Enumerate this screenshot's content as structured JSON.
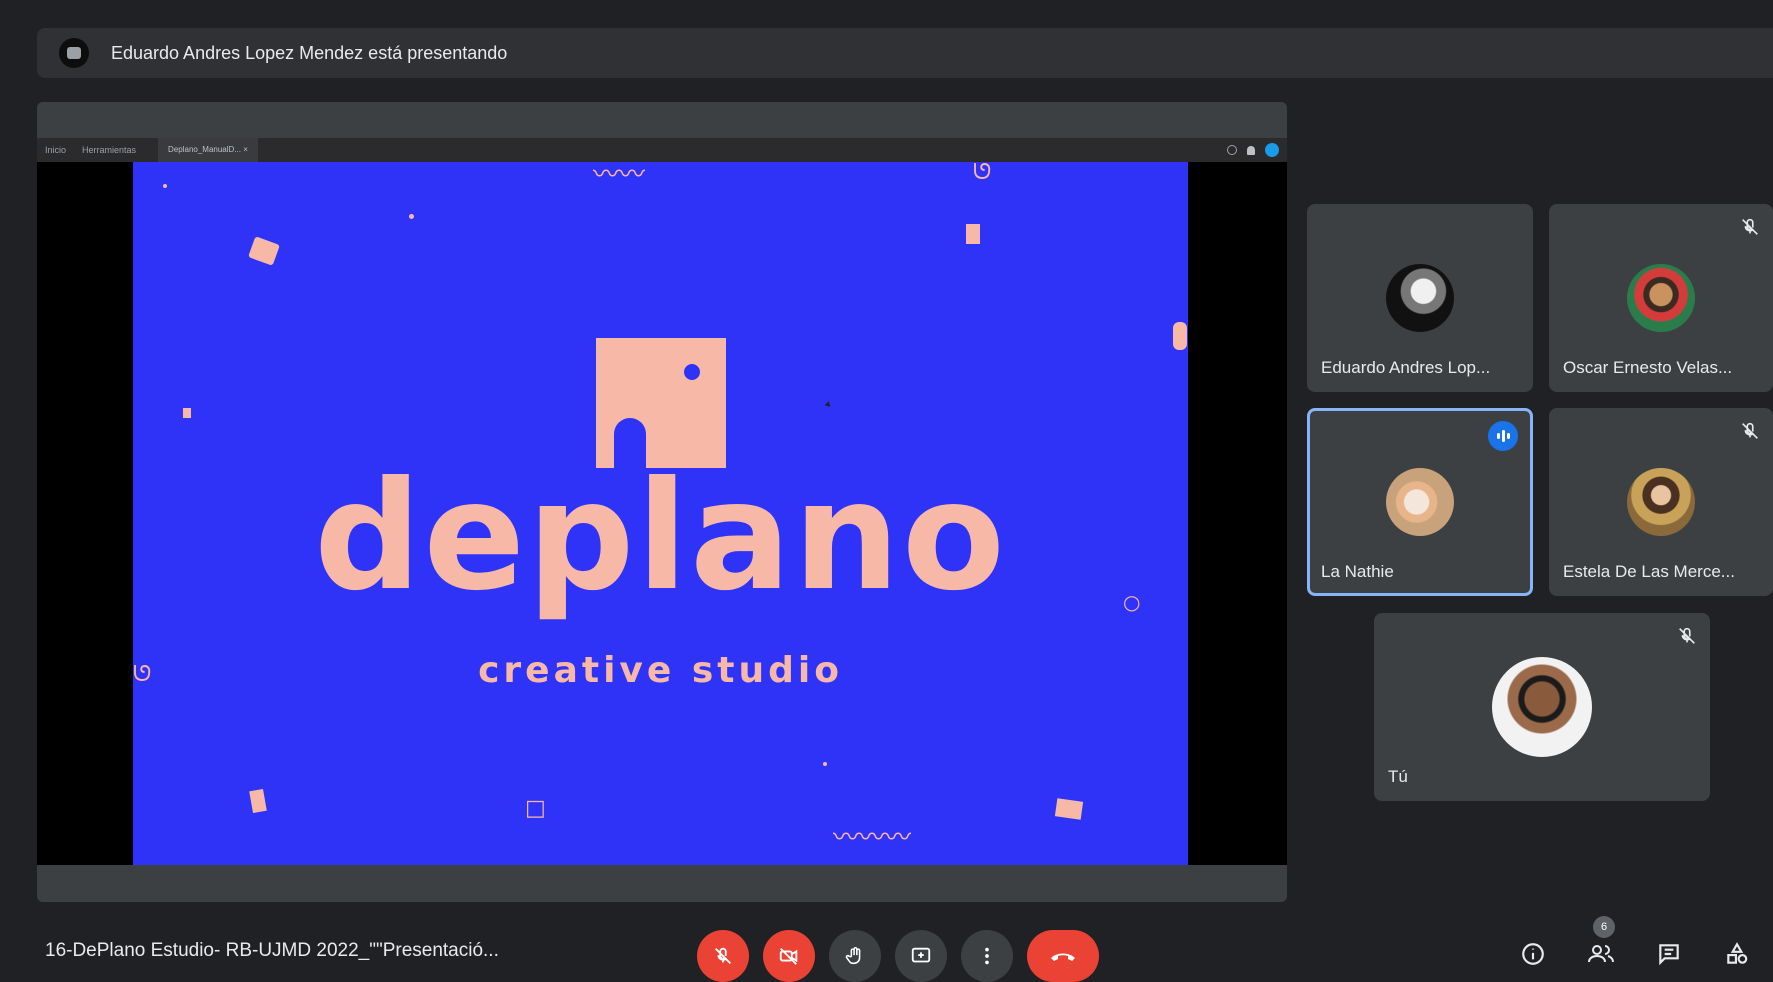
{
  "banner": {
    "text": "Eduardo Andres Lopez Mendez está presentando"
  },
  "browser": {
    "items": [
      "Inicio",
      "Herramientas"
    ],
    "tab_label": "Deplano_ManualD...  ×"
  },
  "slide": {
    "wordmark": "deplano",
    "tagline": "creative studio",
    "colors": {
      "background": "#2f33f7",
      "accent": "#f7b8a8"
    }
  },
  "participants": [
    {
      "name": "Eduardo Andres Lop...",
      "muted": false,
      "speaking": false
    },
    {
      "name": "Oscar Ernesto Velas...",
      "muted": true,
      "speaking": false
    },
    {
      "name": "La Nathie",
      "muted": false,
      "speaking": true
    },
    {
      "name": "Estela De Las Merce...",
      "muted": true,
      "speaking": false
    },
    {
      "name": "Tú",
      "muted": true,
      "speaking": false
    }
  ],
  "meeting": {
    "title": "16-DePlano Estudio- RB-UJMD 2022_\"\"Presentació...",
    "participant_count": "6"
  },
  "controls": {
    "mic": "mic-off-icon",
    "camera": "camera-off-icon",
    "raise_hand": "hand-icon",
    "present": "present-screen-icon",
    "more": "more-vert-icon",
    "leave": "hangup-icon"
  },
  "right_icons": [
    "info-icon",
    "people-icon",
    "chat-icon",
    "activities-icon"
  ]
}
